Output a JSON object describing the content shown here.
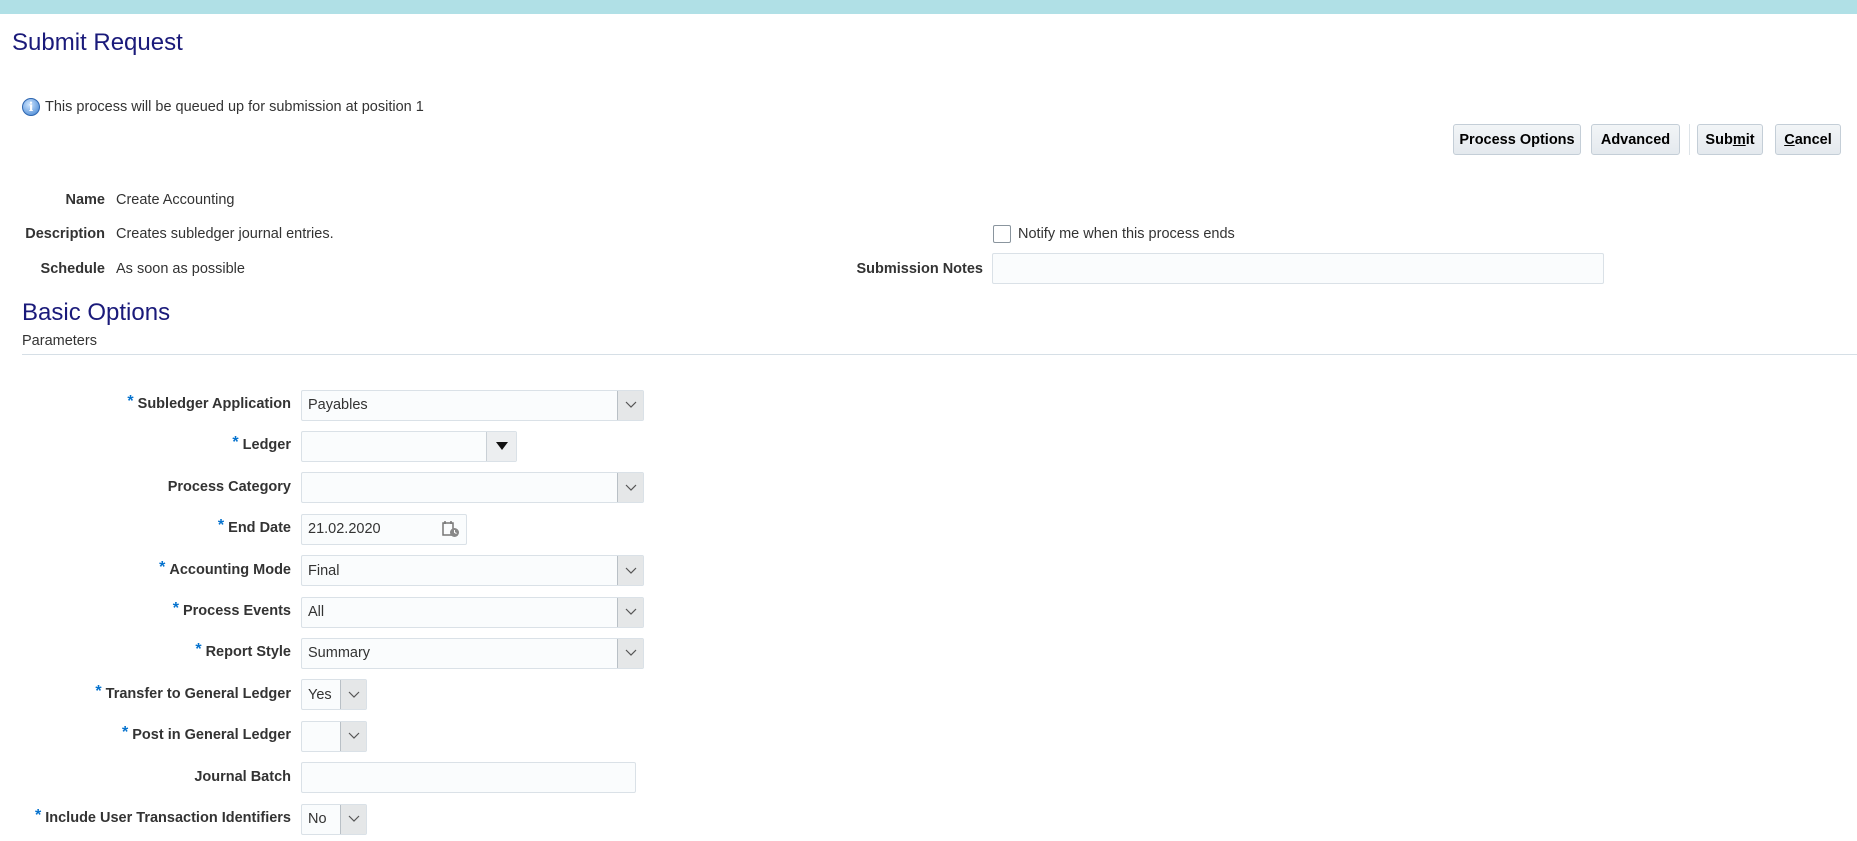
{
  "header": {
    "title": "Submit Request",
    "info_message": "This process will be queued up for submission at position 1"
  },
  "toolbar": {
    "process_options": "Process Options",
    "advanced": "Advanced",
    "submit_pre": "Sub",
    "submit_mn": "m",
    "submit_post": "it",
    "cancel_mn": "C",
    "cancel_post": "ancel"
  },
  "details": {
    "name_label": "Name",
    "name_value": "Create Accounting",
    "description_label": "Description",
    "description_value": "Creates subledger journal entries.",
    "schedule_label": "Schedule",
    "schedule_value": "As soon as possible",
    "notify_label": "Notify me when this process ends",
    "notify_checked": false,
    "submission_notes_label": "Submission Notes",
    "submission_notes_value": ""
  },
  "section": {
    "title": "Basic Options",
    "subtitle": "Parameters"
  },
  "params": [
    {
      "label": "Subledger Application",
      "required": true,
      "value": "Payables",
      "type": "select"
    },
    {
      "label": "Ledger",
      "required": true,
      "value": "",
      "type": "combo"
    },
    {
      "label": "Process Category",
      "required": false,
      "value": "",
      "type": "select"
    },
    {
      "label": "End Date",
      "required": true,
      "value": "21.02.2020",
      "type": "date"
    },
    {
      "label": "Accounting Mode",
      "required": true,
      "value": "Final",
      "type": "select"
    },
    {
      "label": "Process Events",
      "required": true,
      "value": "All",
      "type": "select"
    },
    {
      "label": "Report Style",
      "required": true,
      "value": "Summary",
      "type": "select"
    },
    {
      "label": "Transfer to General Ledger",
      "required": true,
      "value": "Yes",
      "type": "small-select"
    },
    {
      "label": "Post in General Ledger",
      "required": true,
      "value": "",
      "type": "small-select"
    },
    {
      "label": "Journal Batch",
      "required": false,
      "value": "",
      "type": "text"
    },
    {
      "label": "Include User Transaction Identifiers",
      "required": true,
      "value": "No",
      "type": "small-select"
    }
  ],
  "required_marker": "*",
  "colors": {
    "topbar": "#b0e0e6",
    "title": "#1a1a7a",
    "required": "#0572ce"
  }
}
